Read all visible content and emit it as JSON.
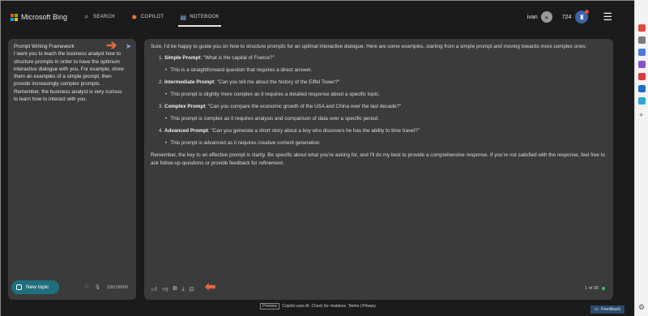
{
  "brand": {
    "name": "Microsoft Bing"
  },
  "nav": [
    {
      "label": "SEARCH",
      "icon": "search-icon"
    },
    {
      "label": "COPILOT",
      "icon": "copilot-icon"
    },
    {
      "label": "NOTEBOOK",
      "icon": "notebook-icon"
    }
  ],
  "user": {
    "name": "ivan",
    "points": "724"
  },
  "prompt": {
    "title": "Prompt Writing Framework",
    "body": "I want you to teach the business analyst how to structure prompts in order to have the optimum interactive dialogue with you. For example, show them an examples of a simple prompt, then provide increasingly complex prompts. Remember, the business analyst is very curious to learn how to interact with you."
  },
  "new_topic_label": "New topic",
  "char_count": "330/18000",
  "reply": {
    "intro": "Sure, I'd be happy to guide you on how to structure prompts for an optimal interactive dialogue. Here are some examples, starting from a simple prompt and moving towards more complex ones:",
    "items": [
      {
        "num": "1.",
        "label": "Simple Prompt",
        "text": ": \"What is the capital of France?\"",
        "note": "This is a straightforward question that requires a direct answer."
      },
      {
        "num": "2.",
        "label": "Intermediate Prompt",
        "text": ": \"Can you tell me about the history of the Eiffel Tower?\"",
        "note": "This prompt is slightly more complex as it requires a detailed response about a specific topic."
      },
      {
        "num": "3.",
        "label": "Complex Prompt",
        "text": ": \"Can you compare the economic growth of the USA and China over the last decade?\"",
        "note": "This prompt is complex as it requires analysis and comparison of data over a specific period."
      },
      {
        "num": "4.",
        "label": "Advanced Prompt",
        "text": ": \"Can you generate a short story about a boy who discovers he has the ability to time travel?\"",
        "note": "This prompt is advanced as it requires creative content generation."
      }
    ],
    "outro": "Remember, the key to an effective prompt is clarity. Be specific about what you're asking for, and I'll do my best to provide a comprehensive response. If you're not satisfied with the response, feel free to ask follow-up questions or provide feedback for refinement."
  },
  "page_indicator": "1 of 30",
  "footer": {
    "preview": "Preview",
    "text": "Copilot uses AI. Check for mistakes.",
    "terms": "Terms",
    "separator": "|",
    "privacy": "Privacy"
  },
  "feedback_label": "Feedback",
  "colors": {
    "accent_teal": "#1f6f7d",
    "arrow": "#e06b3c",
    "panel": "#3b3b3b",
    "background": "#1b1b1b"
  }
}
